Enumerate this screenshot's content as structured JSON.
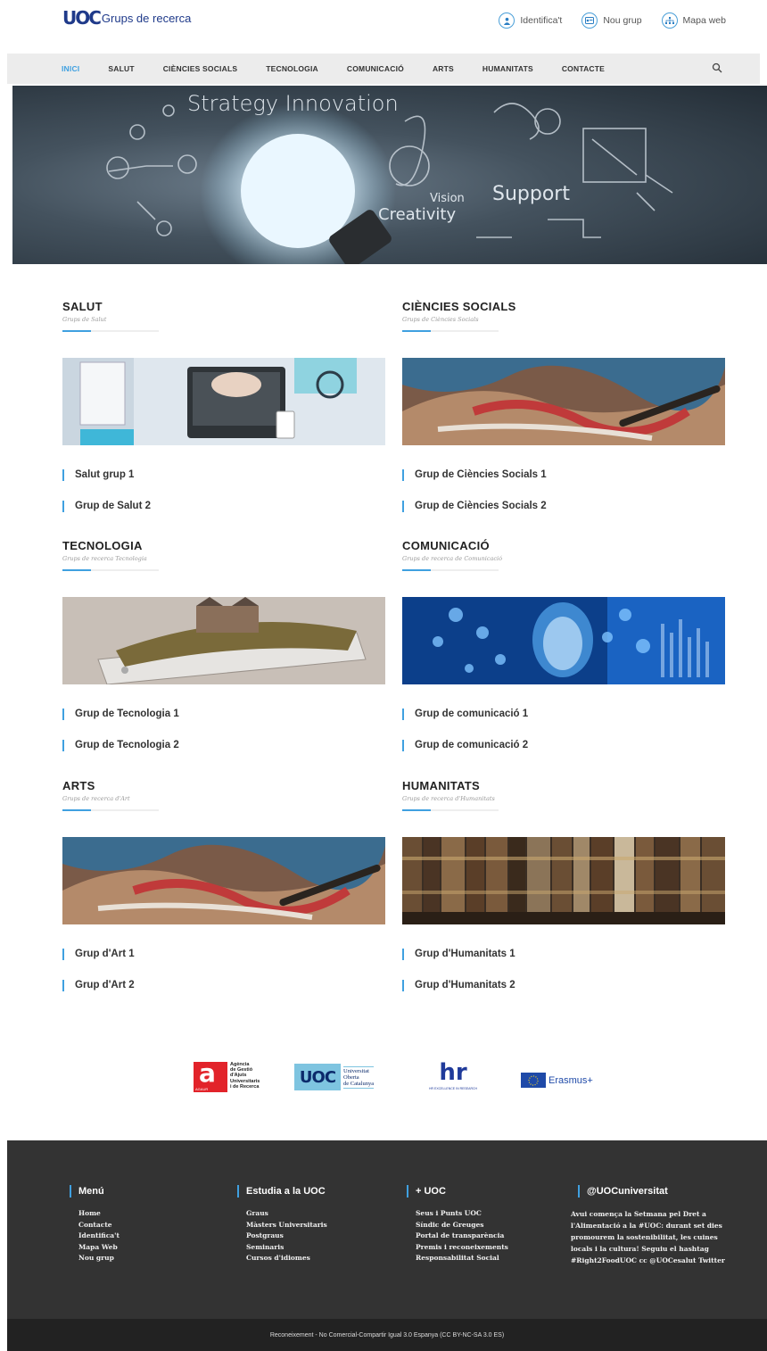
{
  "header": {
    "logo_mark": "UOC",
    "logo_text": "Grups de recerca",
    "links": [
      {
        "label": "Identifica't",
        "icon": "user-icon"
      },
      {
        "label": "Nou grup",
        "icon": "id-card-icon"
      },
      {
        "label": "Mapa web",
        "icon": "sitemap-icon"
      }
    ]
  },
  "nav": {
    "items": [
      "INICI",
      "SALUT",
      "CIÈNCIES SOCIALS",
      "TECNOLOGIA",
      "COMUNICACIÓ",
      "ARTS",
      "HUMANITATS",
      "CONTACTE"
    ],
    "active": "INICI"
  },
  "hero": {
    "words": [
      "Strategy Innovation",
      "Vision",
      "Creativity",
      "Support"
    ]
  },
  "sections": [
    {
      "title": "SALUT",
      "subtitle": "Grups de Salut",
      "groups": [
        "Salut grup 1",
        "Grup de Salut 2"
      ]
    },
    {
      "title": "CIÈNCIES SOCIALS",
      "subtitle": "Grups de Ciències Socials",
      "groups": [
        "Grup de Ciències Socials 1",
        "Grup de Ciències Socials 2"
      ]
    },
    {
      "title": "TECNOLOGIA",
      "subtitle": "Grups de recerca Tecnologia",
      "groups": [
        "Grup de Tecnologia 1",
        "Grup de Tecnologia 2"
      ]
    },
    {
      "title": "COMUNICACIÓ",
      "subtitle": "Grups de recerca de Comunicació",
      "groups": [
        "Grup de comunicació 1",
        "Grup de comunicació 2"
      ]
    },
    {
      "title": "ARTS",
      "subtitle": "Grups de recerca d'Art",
      "groups": [
        "Grup d'Art 1",
        "Grup d'Art 2"
      ]
    },
    {
      "title": "HUMANITATS",
      "subtitle": "Grups de recerca d'Humanitats",
      "groups": [
        "Grup d'Humanitats 1",
        "Grup d'Humanitats 2"
      ]
    }
  ],
  "partners": {
    "agaur": {
      "letter": "a",
      "small": "AGAUR",
      "text": [
        "Agència",
        "de Gestió",
        "d'Ajuts",
        "Universitaris",
        "i de Recerca"
      ]
    },
    "uoc": {
      "mark": "UOC",
      "text": [
        "Universitat",
        "Oberta",
        "de Catalunya"
      ]
    },
    "hr": {
      "mark": "hr",
      "text": "HR EXCELLENCE IN RESEARCH"
    },
    "erasmus": {
      "text": "Erasmus+"
    }
  },
  "footer": {
    "menu": {
      "title": "Menú",
      "items": [
        "Home",
        "Contacte",
        "Identifica't",
        "Mapa Web",
        "Nou grup"
      ]
    },
    "estudia": {
      "title": "Estudia a la UOC",
      "items": [
        "Graus",
        "Màsters Universitaris",
        "Postgraus",
        "Seminaris",
        "Cursos d'idiomes"
      ]
    },
    "mes": {
      "title": "+ UOC",
      "items": [
        "Seus i Punts UOC",
        "Síndic de Greuges",
        "Portal de transparència",
        "Premis i reconeixements",
        "Responsabilitat Social"
      ]
    },
    "twitter": {
      "title": "@UOCuniversitat",
      "text": "Avui comença la Setmana pel Dret a l'Alimentació a la #UOC: durant set dies promourem la sostenibilitat, les cuines locals i la cultura! Seguiu el hashtag #Right2FoodUOC cc @UOCesalut Twitter"
    },
    "license": "Reconeixement - No Comercial-Compartir Igual 3.0 Espanya (CC BY-NC-SA 3.0 ES)"
  },
  "colors": {
    "accent": "#3fa0e0",
    "footer_bg": "#333333",
    "bottom_bg": "#222222",
    "nav_bg": "#ececec"
  }
}
